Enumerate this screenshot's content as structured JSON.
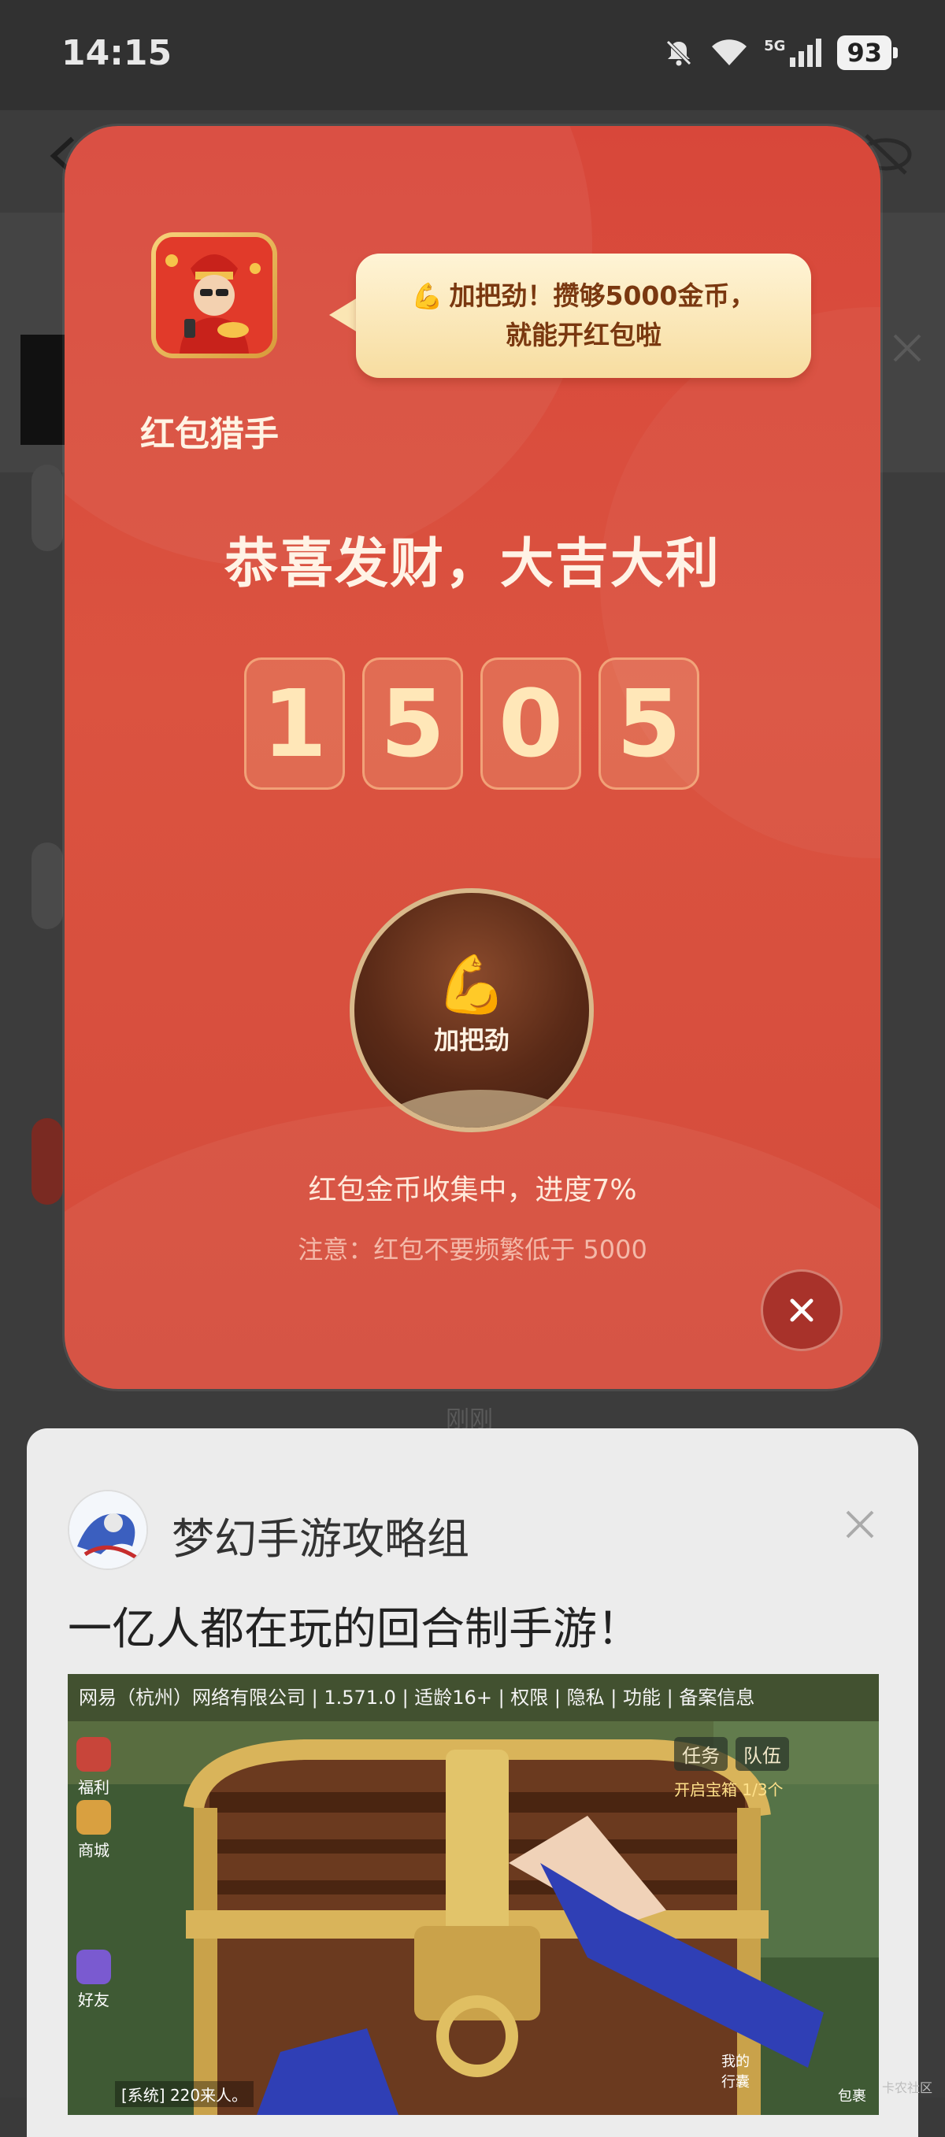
{
  "status_bar": {
    "time": "14:15",
    "network": "5G",
    "battery": "93",
    "icons": [
      "bell-muted-icon",
      "wifi-icon",
      "signal-icon",
      "battery-icon"
    ]
  },
  "background": {
    "timestamp": "刚刚"
  },
  "modal": {
    "app_name": "红包猎手",
    "tip": {
      "emoji": "💪",
      "line1": "加把劲！攒够5000金币，",
      "line2": "就能开红包啦"
    },
    "headline": "恭喜发财，大吉大利",
    "coin_digits": [
      "1",
      "5",
      "0",
      "5"
    ],
    "boost_button": {
      "emoji": "💪",
      "label": "加把劲"
    },
    "progress_text": "红包金币收集中，进度7%",
    "progress_percent": 7,
    "note": "注意：红包不要频繁低于 5000",
    "accent_color": "#d8473a"
  },
  "ad": {
    "name": "梦幻手游攻略组",
    "title": "一亿人都在玩的回合制手游！",
    "legal": "网易（杭州）网络有限公司 | 1.571.0 | 适龄16+ | 权限 | 隐私 | 功能 | 备案信息",
    "game_ui": {
      "side_labels": [
        "福利",
        "商城",
        "好友"
      ],
      "task_chip": "任务",
      "team_chip": "队伍",
      "task_sub": "开启宝箱  1/3个",
      "bottom_text": "[系统] 220来人。",
      "bag_label": "包裹",
      "action_label": "我的行囊"
    }
  },
  "watermark": "卡农社区"
}
